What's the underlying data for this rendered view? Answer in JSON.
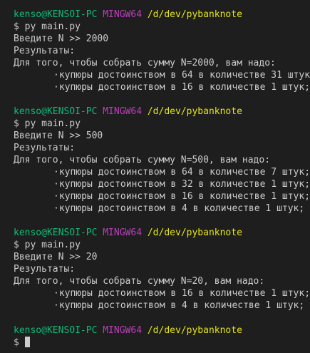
{
  "theme": {
    "background": "#1e1e1e",
    "foreground": "#cccccc",
    "prompt_user_color": "#0dbc79",
    "prompt_env_color": "#bc3fbc",
    "prompt_path_color": "#e5e510"
  },
  "prompt": {
    "user_host": "kenso@KENSOI-PC",
    "env": "MINGW64",
    "path": "/d/dev/pybanknote",
    "symbol": "$"
  },
  "sessions": [
    {
      "command": "py main.py",
      "input_line": "Введите N >> 2000",
      "results_header": "Результаты:",
      "summary": "Для того, чтобы собрать сумму N=2000, вам надо:",
      "items": [
        "·купюры достоинством в 64 в количестве 31 штук;",
        "·купюры достоинством в 16 в количестве 1 штук;"
      ]
    },
    {
      "command": "py main.py",
      "input_line": "Введите N >> 500",
      "results_header": "Результаты:",
      "summary": "Для того, чтобы собрать сумму N=500, вам надо:",
      "items": [
        "·купюры достоинством в 64 в количестве 7 штук;",
        "·купюры достоинством в 32 в количестве 1 штук;",
        "·купюры достоинством в 16 в количестве 1 штук;",
        "·купюры достоинством в 4 в количестве 1 штук;"
      ]
    },
    {
      "command": "py main.py",
      "input_line": "Введите N >> 20",
      "results_header": "Результаты:",
      "summary": "Для того, чтобы собрать сумму N=20, вам надо:",
      "items": [
        "·купюры достоинством в 16 в количестве 1 штук;",
        "·купюры достоинством в 4 в количестве 1 штук;"
      ]
    }
  ]
}
